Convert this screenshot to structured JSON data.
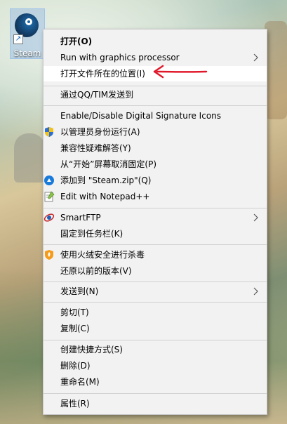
{
  "desktop": {
    "icon_label": "Steam"
  },
  "context_menu": {
    "items": [
      {
        "label": "打开(O)",
        "bold": true
      },
      {
        "label": "Run with graphics processor",
        "submenu": true
      },
      {
        "label": "打开文件所在的位置(I)",
        "highlighted": true
      },
      {
        "label": "通过QQ/TIM发送到"
      },
      {
        "label": "Enable/Disable Digital Signature Icons"
      },
      {
        "label": "以管理员身份运行(A)",
        "icon": "uac-shield-icon"
      },
      {
        "label": "兼容性疑难解答(Y)"
      },
      {
        "label": "从“开始”屏幕取消固定(P)"
      },
      {
        "label": "添加到 \"Steam.zip\"(Q)",
        "icon": "archive-icon"
      },
      {
        "label": "Edit with Notepad++",
        "icon": "notepadpp-icon"
      },
      {
        "label": "SmartFTP",
        "icon": "smartftp-icon",
        "submenu": true
      },
      {
        "label": "固定到任务栏(K)"
      },
      {
        "label": "使用火绒安全进行杀毒",
        "icon": "huorong-icon"
      },
      {
        "label": "还原以前的版本(V)"
      },
      {
        "label": "发送到(N)",
        "submenu": true
      },
      {
        "label": "剪切(T)"
      },
      {
        "label": "复制(C)"
      },
      {
        "label": "创建快捷方式(S)"
      },
      {
        "label": "删除(D)"
      },
      {
        "label": "重命名(M)"
      },
      {
        "label": "属性(R)"
      }
    ]
  },
  "colors": {
    "menu_background": "#f2f2f2",
    "highlight": "#ffffff",
    "annotation_arrow": "#e0182a"
  }
}
